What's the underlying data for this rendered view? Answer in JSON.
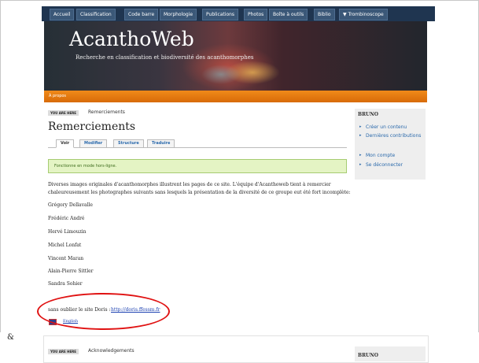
{
  "nav": {
    "tabs": [
      "Accueil",
      "Classification",
      "Code barre",
      "Morphologie",
      "Publications",
      "Photos",
      "Boîte à outils",
      "Biblio",
      "▼ Trombinoscope"
    ]
  },
  "header": {
    "site_name": "AcanthoWeb",
    "slogan": "Recherche en classification et biodiversité des acanthomorphes",
    "apropos": "À propos"
  },
  "breadcrumb": {
    "label": "YOU ARE HERE",
    "current": "Remerciements"
  },
  "main": {
    "title": "Remerciements",
    "tabs": [
      "Voir",
      "Modifier",
      "Structure",
      "Traduire"
    ],
    "message": "Fonctionne en mode hors-ligne.",
    "intro_line1": "Diverses images originales d'acanthomorphes illustrent les pages de ce site. L'équipe d'Acanthoweb tient à remercier",
    "intro_line2": "chaleureusement les photographes suivants sans lesquels la présentation de la diversité de ce groupe eut été fort incomplète:",
    "photographers": [
      "Grégory Dellavalle",
      "Frédéric André",
      "Hervé Limouzin",
      "Michel Lonfat",
      "Vincent Maran",
      "Alain-Pierre Sittler",
      "Sandra Sohier"
    ],
    "doris_text": "sans oublier le site Doris :",
    "doris_link": "http://doris.ffessm.fr",
    "language": "English"
  },
  "sidebar": {
    "title": "BRUNO",
    "items": [
      "Créer un contenu",
      "Dernières contributions",
      "Mon compte",
      "Se déconnecter"
    ]
  },
  "lower": {
    "ampersand": "&",
    "breadcrumb_label": "YOU ARE HERE",
    "breadcrumb_current": "Acknowledgements",
    "sidebar_title": "BRUNO"
  }
}
